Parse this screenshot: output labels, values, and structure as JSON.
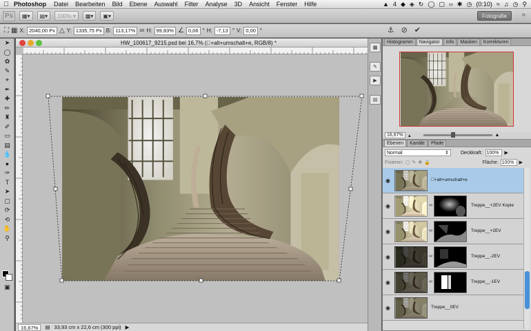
{
  "menubar": {
    "app_name": "Photoshop",
    "menus": [
      "Datei",
      "Bearbeiten",
      "Bild",
      "Ebene",
      "Auswahl",
      "Filter",
      "Analyse",
      "3D",
      "Ansicht",
      "Fenster",
      "Hilfe"
    ],
    "status": {
      "adobe_count": "4",
      "battery": "(0:10)"
    }
  },
  "appbar": {
    "logo": "Ps",
    "zoom": "100%",
    "workspace": "Fotografie"
  },
  "options": {
    "x_label": "X:",
    "x_value": "2040,00 Px",
    "y_label": "Y:",
    "y_value": "1335,75 Px",
    "w_label": "B:",
    "w_value": "113,17%",
    "h_label": "H:",
    "h_value": "99,83%",
    "rot_value": "0,06",
    "deg": "°",
    "hskew_label": "H:",
    "hskew_value": "-7,13",
    "vskew_label": "V:",
    "vskew_value": "0,00"
  },
  "document": {
    "title": "HW_100617_9215.psd bei 16,7% (+alt+umschalt+e, RGB/8) *",
    "zoom": "16,67%",
    "doc_info": "33,93 cm x 22,6 cm (300 ppi)"
  },
  "navigator": {
    "tabs": [
      "Histogramm",
      "Navigator",
      "Info",
      "Masken",
      "Korrekturen"
    ],
    "active_tab": "Navigator",
    "zoom": "16,67%"
  },
  "layers_panel": {
    "tabs": [
      "Ebenen",
      "Kanäle",
      "Pfade"
    ],
    "blend_mode": "Normal",
    "opacity_label": "Deckkraft:",
    "opacity": "100%",
    "lock_label": "Fixieren:",
    "fill_label": "Fläche:",
    "fill": "100%",
    "layers": [
      {
        "name": "+alt+umschalt+e",
        "selected": true,
        "has_mask": false
      },
      {
        "name": "Treppe__+2EV Kopie",
        "selected": false,
        "has_mask": true
      },
      {
        "name": "Treppe__+2EV",
        "selected": false,
        "has_mask": true
      },
      {
        "name": "Treppe__-2EV",
        "selected": false,
        "has_mask": true
      },
      {
        "name": "Treppe__-1EV",
        "selected": false,
        "has_mask": true
      },
      {
        "name": "Treppe__0EV",
        "selected": false,
        "has_mask": false
      }
    ]
  },
  "colors": {
    "selection_blue": "#a9cbe9",
    "nav_frame": "#d03333"
  }
}
